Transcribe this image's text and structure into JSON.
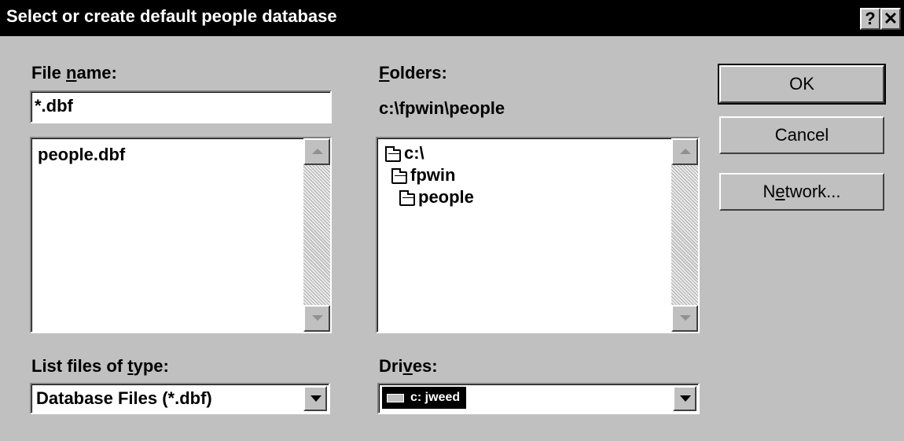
{
  "window": {
    "title": "Select or create default people database",
    "help_label": "?",
    "close_label": "✕"
  },
  "file_name": {
    "label_pre": "File ",
    "label_u": "n",
    "label_post": "ame:",
    "value": "*.dbf",
    "files": [
      "people.dbf"
    ]
  },
  "folders": {
    "label_u": "F",
    "label_post": "olders:",
    "current_path": "c:\\fpwin\\people",
    "items": [
      {
        "name": "c:\\",
        "icon": "open-folder-icon"
      },
      {
        "name": "fpwin",
        "icon": "open-folder-icon"
      },
      {
        "name": "people",
        "icon": "open-folder-icon"
      }
    ]
  },
  "file_type": {
    "label_pre": "List files of ",
    "label_u": "t",
    "label_post": "ype:",
    "value": "Database Files (*.dbf)"
  },
  "drives": {
    "label_pre": "Dri",
    "label_u": "v",
    "label_post": "es:",
    "value": "c: jweed",
    "icon": "drive-icon"
  },
  "buttons": {
    "ok": "OK",
    "cancel": "Cancel",
    "network_pre": "N",
    "network_u": "e",
    "network_post": "twork..."
  }
}
